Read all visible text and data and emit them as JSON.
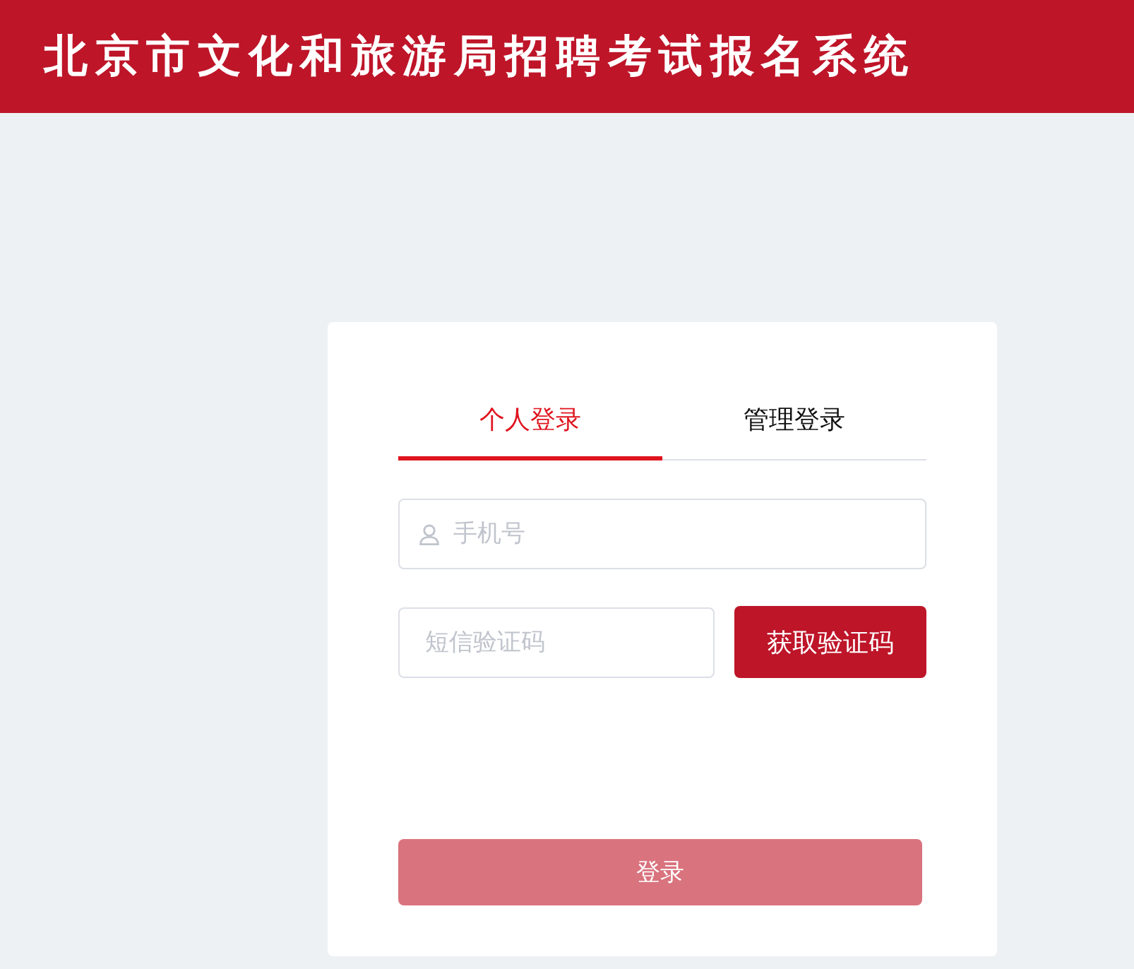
{
  "header": {
    "title": "北京市文化和旅游局招聘考试报名系统"
  },
  "login_tabs": [
    {
      "label": "个人登录",
      "selected": true
    },
    {
      "label": "管理登录",
      "selected": false
    }
  ],
  "phone_field": {
    "placeholder": "手机号"
  },
  "code_field": {
    "placeholder": "短信验证码"
  },
  "get_code_button": {
    "label": "获取验证码"
  },
  "login_button": {
    "label": "登录",
    "disabled": true
  }
}
